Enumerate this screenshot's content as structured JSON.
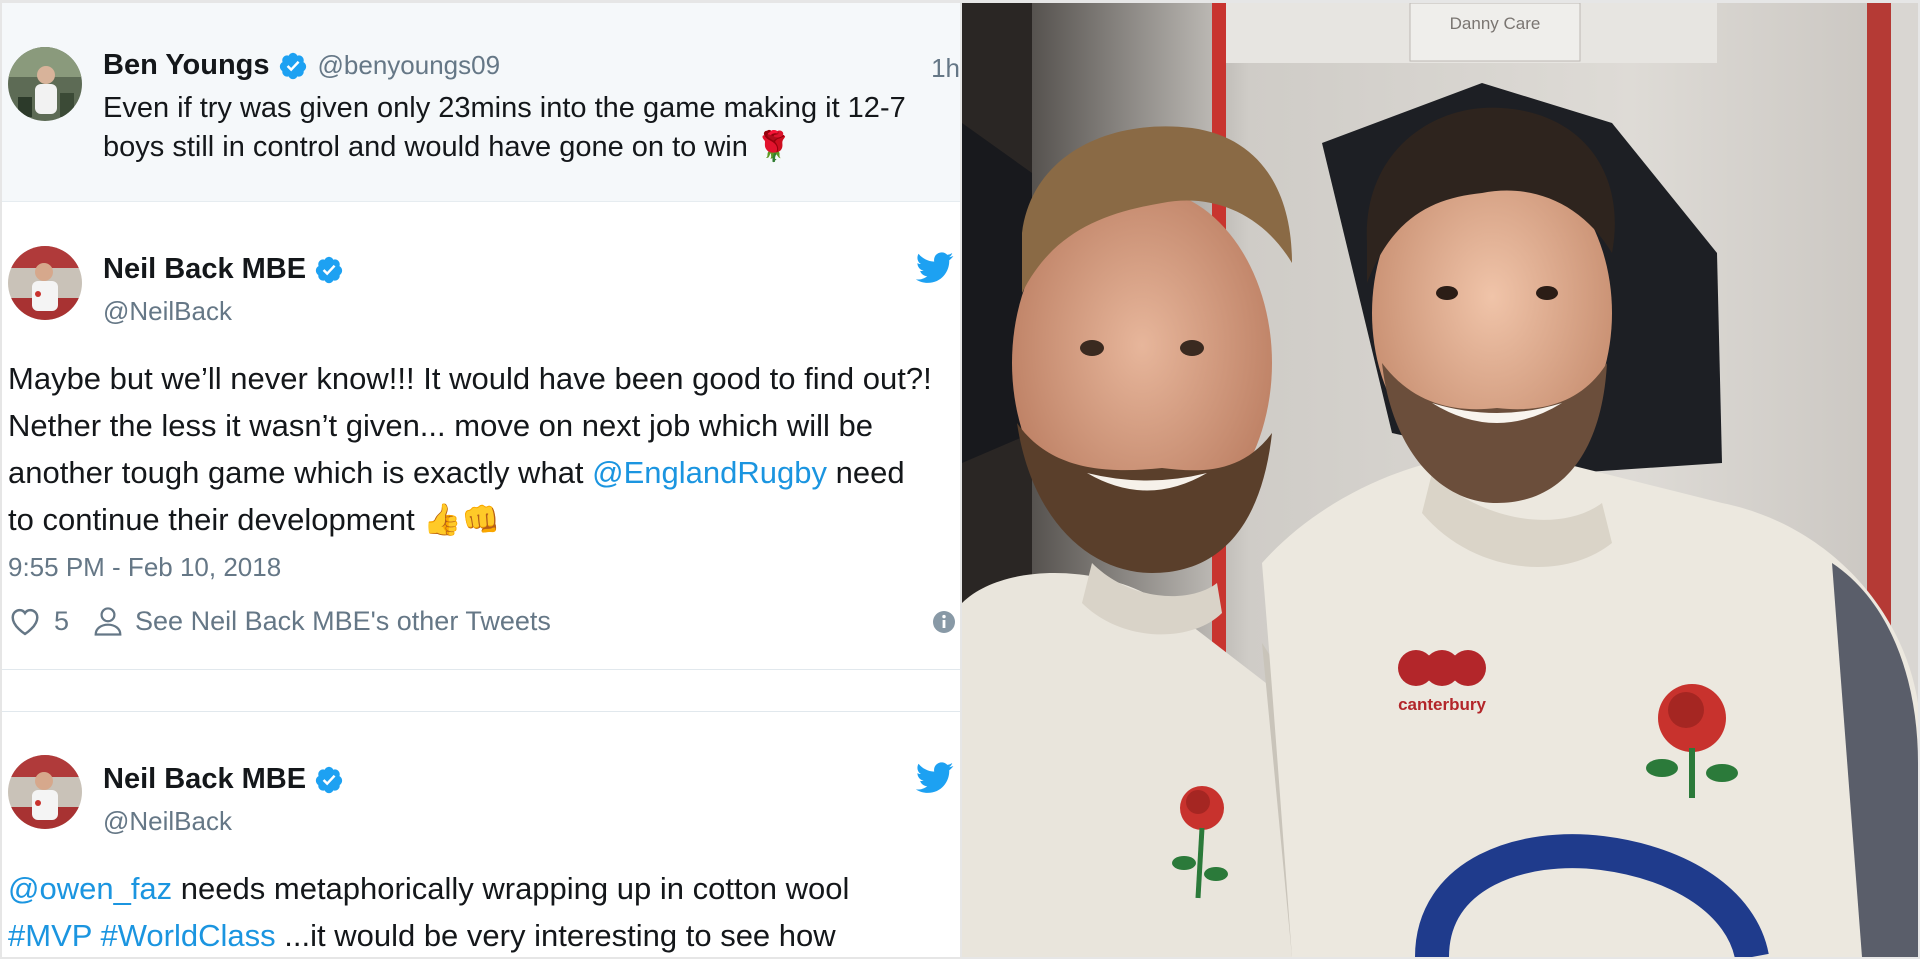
{
  "reply_tweet": {
    "name": "Ben Youngs",
    "handle": "@benyoungs09",
    "time": "1h",
    "text": "Even if try was given only 23mins into the game making it 12-7 boys still in control and would have gone on to win 🌹"
  },
  "tweet1": {
    "name": "Neil Back MBE",
    "handle": "@NeilBack",
    "text_1": "Maybe but we’ll never know!!! It would have been good to find out?! Nether the less it wasn’t given... move on next job which will be another tough game which is exactly what ",
    "mention": "@EnglandRugby",
    "text_2": " need to continue their development 👍👊",
    "timestamp": "9:55 PM - Feb 10, 2018",
    "likes": "5",
    "other_tweets": "See Neil Back MBE's other Tweets"
  },
  "tweet2": {
    "name": "Neil Back MBE",
    "handle": "@NeilBack",
    "mention": "@owen_faz",
    "text_1": " needs metaphorically wrapping up in cotton wool ",
    "hashtag1": "#MVP",
    "hashtag2": "#WorldClass",
    "text_2": " ...it would be very interesting to see how"
  },
  "photo": {
    "plaque_text": "Danny Care",
    "shirt_brand": "canterbury"
  },
  "colors": {
    "twitter_blue": "#1da1f2",
    "link_blue": "#1b95e0",
    "muted": "#657786",
    "reply_bg": "#f5f8fa"
  }
}
